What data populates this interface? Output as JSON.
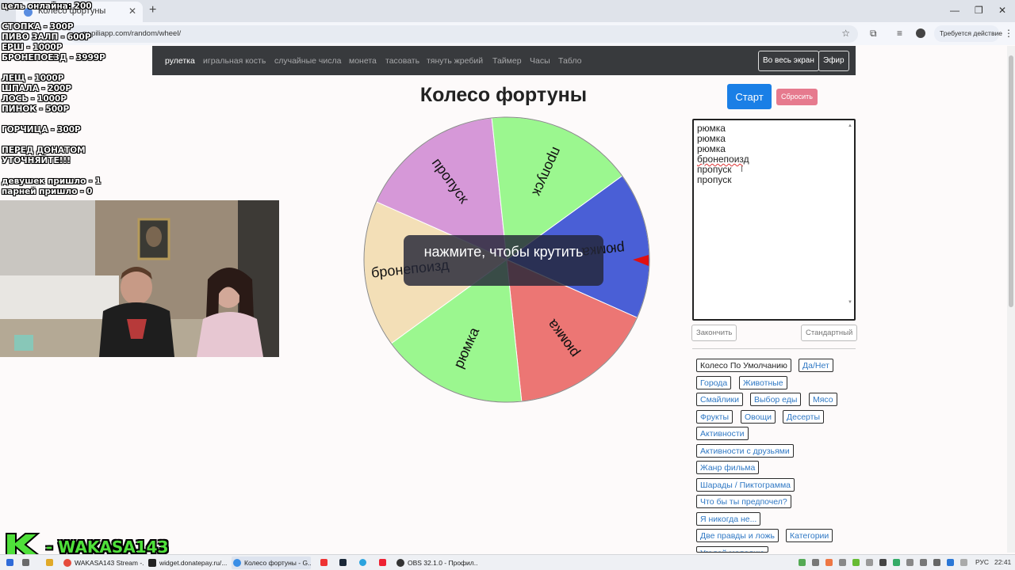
{
  "browser": {
    "tab_title": "Колесо фортуны",
    "url": "ru.piliapp.com/random/wheel/",
    "action_label": "Требуется действие"
  },
  "nav": {
    "links": [
      "рулетка",
      "игральная кость",
      "случайные числа",
      "монета",
      "тасовать",
      "тянуть жребий",
      "Таймер",
      "Часы",
      "Табло"
    ],
    "fullscreen_label": "Во весь экран",
    "broadcast_label": "Эфир"
  },
  "page": {
    "title": "Колесо фортуны",
    "start_label": "Старт",
    "reset_label": "Сбросить",
    "spin_overlay": "нажмите, чтобы крутить"
  },
  "wheel": {
    "segments": [
      {
        "label": "рюмка",
        "color": "#4a5fd6"
      },
      {
        "label": "рюмка",
        "color": "#ec7674"
      },
      {
        "label": "рюмка",
        "color": "#9bf78f"
      },
      {
        "label": "бронепоизд",
        "color": "#f3dfb7"
      },
      {
        "label": "пропуск",
        "color": "#d698d8"
      },
      {
        "label": "пропуск",
        "color": "#9bf78f"
      }
    ],
    "pointer_color": "#e01010"
  },
  "editor": {
    "lines": [
      "рюмка",
      "рюмка",
      "рюмка",
      "бронепоизд",
      "пропуск",
      "пропуск"
    ],
    "finish_label": "Закончить",
    "standard_label": "Стандартный"
  },
  "presets": [
    "Колесо По Умолчанию",
    "Да/Нет",
    "Города",
    "Животные",
    "Смайлики",
    "Выбор еды",
    "Мясо",
    "Фрукты",
    "Овощи",
    "Десерты",
    "Активности",
    "Активности с друзьями",
    "Жанр фильма",
    "Шарады / Пиктограмма",
    "Что бы ты предпочел?",
    "Я никогда не...",
    "Две правды и ложь",
    "Категории",
    "Угадай мелодию"
  ],
  "stream_overlay": {
    "lines": [
      "цель онлайна: 200",
      "",
      "СТОПКА - 300Р",
      "ПИВО ЗАЛП - 600Р",
      "ЕРШ - 1000Р",
      "БРОНЕПОЕЗД - 3999Р",
      "",
      "ЛЕЩ - 1000Р",
      "ШПАЛА - 200Р",
      "ЛОСЬ - 1000Р",
      "ПИНОК - 500Р",
      "",
      "ГОРЧИЦА - 300Р",
      "",
      "ПЕРЕД ДОНАТОМ",
      "УТОЧНЯЙТЕ!!!",
      "",
      "девушек пришло - 1",
      "парней пришло - 0"
    ],
    "logo_text": "- WAKASA143",
    "logo_color": "#4fe03a"
  },
  "taskbar": {
    "items": [
      "WAKASA143 Stream -...",
      "widget.donatepay.ru/...",
      "Колесо фортуны - G...",
      "OBS 32.1.0 - Профил..."
    ],
    "language": "РУС",
    "time": "22:41"
  }
}
